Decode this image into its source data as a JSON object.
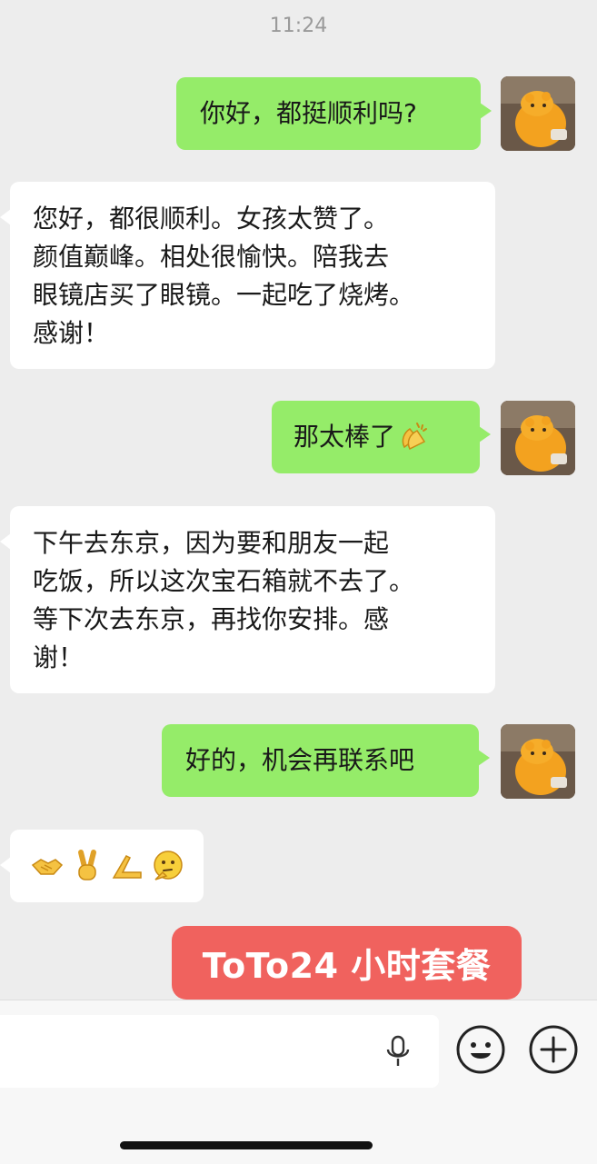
{
  "status": {
    "time": "11:24"
  },
  "messages": [
    {
      "side": "me",
      "text": "你好，都挺顺利吗?"
    },
    {
      "side": "them",
      "lines": [
        "您好，都很顺利。女孩太赞了。",
        "颜值巅峰。相处很愉快。陪我去",
        "眼镜店买了眼镜。一起吃了烧烤。",
        "感谢！"
      ]
    },
    {
      "side": "me",
      "text": "那太棒了",
      "emoji": "clapping-hands"
    },
    {
      "side": "them",
      "lines": [
        "下午去东京，因为要和朋友一起",
        "吃饭，所以这次宝石箱就不去了。",
        "等下次去东京，再找你安排。感",
        "谢！"
      ]
    },
    {
      "side": "me",
      "text": "好的，机会再联系吧"
    },
    {
      "side": "them",
      "emojis": [
        "handshake",
        "victory-hand",
        "pinched-fingers",
        "thinking-face"
      ]
    }
  ],
  "promo": {
    "text": "ToTo24 小时套餐"
  },
  "input_bar": {
    "icons": [
      "microphone-icon",
      "emoji-face-icon",
      "plus-circle-icon"
    ]
  }
}
